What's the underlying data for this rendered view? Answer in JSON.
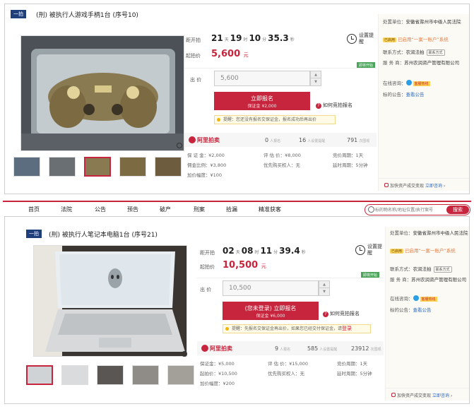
{
  "panel1": {
    "tag": "一拍",
    "title": "(刑) 被执行人游戏手柄1台 (序号10)",
    "countdown_label": "距开拍",
    "countdown": {
      "d": "21",
      "d_unit": "天",
      "h": "19",
      "h_unit": "时",
      "m": "10",
      "m_unit": "分",
      "s": "35.3",
      "s_unit": "秒"
    },
    "start_price_label": "起拍价",
    "start_price": "5,600",
    "price_unit": "元",
    "remind": "设置提醒",
    "green_badge": "即将开始",
    "bid_label": "出 价",
    "bid_value": "5,600",
    "register": "立即报名",
    "register_sub": "保证金 ¥2,000",
    "help": "如何竞拍报名",
    "tip_text": "提醒：您还没有报名交保证金，报名成功后再出价",
    "brand": "阿里拍卖",
    "stats": [
      {
        "value": "0",
        "label": "人报名"
      },
      {
        "value": "16",
        "label": "人设置提醒"
      },
      {
        "value": "791",
        "label": "次围观"
      }
    ],
    "details": {
      "deposit": "保 证 金：¥2,000",
      "appraisal": "评 估 价：¥8,000",
      "cycle": "竞价周期：1天",
      "increment": "加价幅度：¥100",
      "priority": "优先购买权人：无",
      "extend": "延时周期：5分钟",
      "commission": "佣金比例：¥3,800"
    },
    "side": {
      "unit_label": "处置单位：",
      "unit": "安徽省滁州市中级人民法院",
      "badge": "已启用",
      "badge_text": "已启用“一案一账户”系统",
      "contact_label": "联系方式：",
      "contact": "农润法拍",
      "contact_btn": "联系方式",
      "service_label": "服 务 商：",
      "service": "苏州农润资产管理有限公司",
      "online_label": "在线咨询：",
      "online_btn": "客服热线",
      "notice_label": "标的公告：",
      "notice": "查看公告",
      "bottom": "加快资产成交变现",
      "bottom_link": "立即咨询"
    }
  },
  "nav": {
    "items": [
      "首页",
      "法院",
      "公告",
      "预告",
      "破产",
      "刑案",
      "拾漏",
      "精准获客"
    ],
    "search_placeholder": "标的物名称/地址位置/执行案号",
    "search_btn": "搜索"
  },
  "panel2": {
    "tag": "一拍",
    "title": "(刑) 被执行人笔记本电脑1台 (序号21)",
    "countdown_label": "距开拍",
    "countdown": {
      "d": "02",
      "d_unit": "天",
      "h": "08",
      "h_unit": "时",
      "m": "11",
      "m_unit": "分",
      "s": "39.4",
      "s_unit": "秒"
    },
    "start_price_label": "起拍价",
    "start_price": "10,500",
    "price_unit": "元",
    "remind": "设置提醒",
    "green_badge": "即将开始",
    "bid_label": "出 价",
    "bid_value": "10,500",
    "register": "(您未登录) 立即报名",
    "register_sub": "保证金 ¥6,000",
    "help": "如何竞拍报名",
    "tip_text": "提醒：先报名交保证金再出价，如果您已经交付保证金，请",
    "tip_link": "登录",
    "brand": "阿里拍卖",
    "stats": [
      {
        "value": "9",
        "label": "人报名"
      },
      {
        "value": "585",
        "label": "人设置提醒"
      },
      {
        "value": "23912",
        "label": "次围观"
      }
    ],
    "details": {
      "deposit": "保证金：¥5,000",
      "appraisal": "评 估 价：¥15,000",
      "cycle": "竞价周期：1天",
      "start": "起拍价：¥10,500",
      "priority": "优先购买权人：无",
      "extend": "延时周期：5分钟",
      "increment": "加价幅度：¥200"
    },
    "side": {
      "unit_label": "处置单位：",
      "unit": "安徽省滁州市中级人民法院",
      "badge": "已启用",
      "badge_text": "已启用“一案一账户”系统",
      "contact_label": "联系方式：",
      "contact": "农润法拍",
      "contact_btn": "联系方式",
      "service_label": "服 务 商：",
      "service": "苏州农润资产管理有限公司",
      "online_label": "在线咨询：",
      "online_btn": "客服热线",
      "notice_label": "标的公告：",
      "notice": "查看公告",
      "bottom": "加快资产成交变现",
      "bottom_link": "立即咨询"
    }
  }
}
